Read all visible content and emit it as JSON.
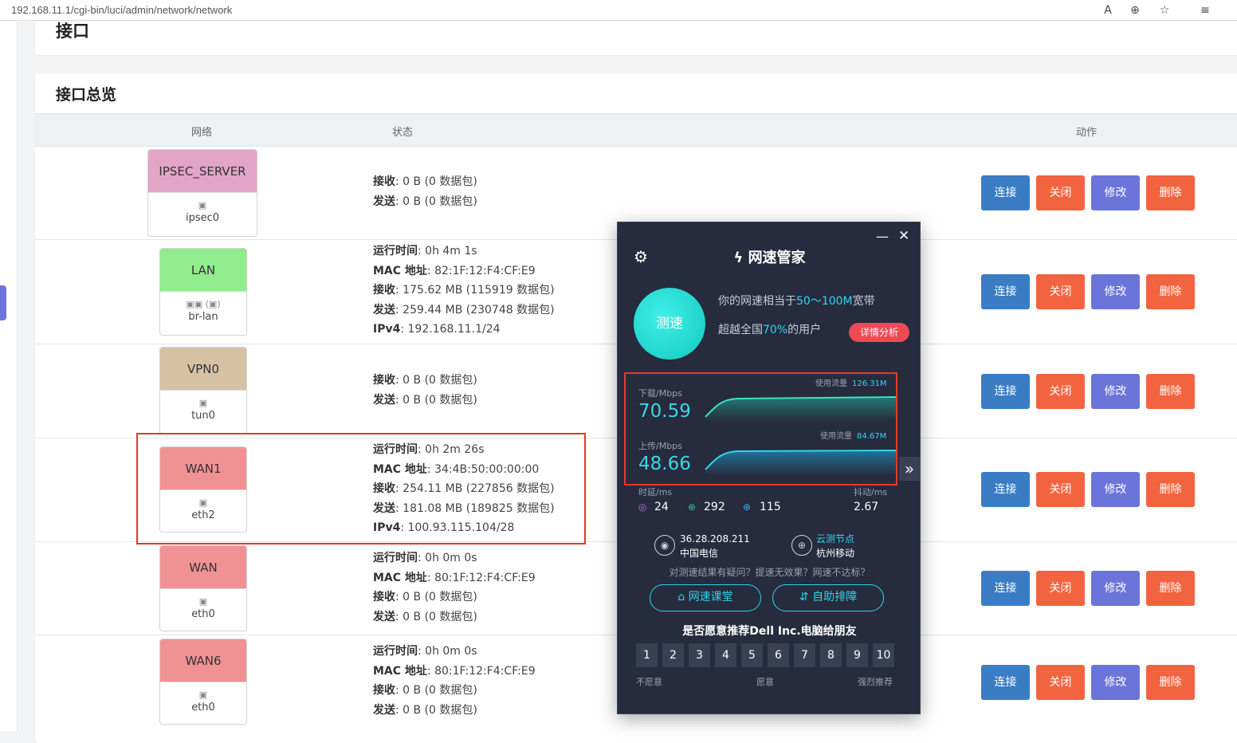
{
  "browser": {
    "url": "192.168.11.1/cgi-bin/luci/admin/network/network",
    "icons": [
      "read-aloud-icon",
      "zoom-icon",
      "favorite-add-icon",
      "favorites-icon"
    ]
  },
  "page": {
    "title": "接口",
    "section_title": "接口总览",
    "columns": {
      "network": "网络",
      "status": "状态",
      "actions": "动作"
    }
  },
  "labels": {
    "uptime": "运行时间",
    "mac": "MAC 地址",
    "rx": "接收",
    "tx": "发送",
    "ipv4": "IPv4"
  },
  "buttons": {
    "connect": "连接",
    "close": "关闭",
    "edit": "修改",
    "delete": "删除"
  },
  "interfaces": [
    {
      "name": "IPSEC_SERVER",
      "device": "ipsec0",
      "color": "#e2a5c7",
      "icon": "ethernet-port-icon",
      "uptime": null,
      "mac": null,
      "rx": "0 B (0 数据包)",
      "tx": "0 B (0 数据包)",
      "ipv4": null
    },
    {
      "name": "LAN",
      "device": "br-lan",
      "color": "#90ec8c",
      "icon": "bridge-icon",
      "uptime": "0h 4m 1s",
      "mac": "82:1F:12:F4:CF:E9",
      "rx": "175.62 MB (115919 数据包)",
      "tx": "259.44 MB (230748 数据包)",
      "ipv4": "192.168.11.1/24"
    },
    {
      "name": "VPN0",
      "device": "tun0",
      "color": "#d6c1a4",
      "icon": "ethernet-port-icon",
      "uptime": null,
      "mac": null,
      "rx": "0 B (0 数据包)",
      "tx": "0 B (0 数据包)",
      "ipv4": null
    },
    {
      "name": "WAN1",
      "device": "eth2",
      "color": "#f09294",
      "icon": "ethernet-port-icon",
      "uptime": "0h 2m 26s",
      "mac": "34:4B:50:00:00:00",
      "rx": "254.11 MB (227856 数据包)",
      "tx": "181.08 MB (189825 数据包)",
      "ipv4": "100.93.115.104/28"
    },
    {
      "name": "WAN",
      "device": "eth0",
      "color": "#f09294",
      "icon": "ethernet-port-icon",
      "uptime": "0h 0m 0s",
      "mac": "80:1F:12:F4:CF:E9",
      "rx": "0 B (0 数据包)",
      "tx": "0 B (0 数据包)",
      "ipv4": null
    },
    {
      "name": "WAN6",
      "device": "eth0",
      "color": "#f09294",
      "icon": "ethernet-port-icon",
      "uptime": "0h 0m 0s",
      "mac": "80:1F:12:F4:CF:E9",
      "rx": "0 B (0 数据包)",
      "tx": "0 B (0 数据包)",
      "ipv4": null
    }
  ],
  "speed_popup": {
    "title": "网速管家",
    "test_button": "测速",
    "line1_prefix": "你的网速相当于",
    "line1_value": "50～100M",
    "line1_suffix": "宽带",
    "line2_prefix": "超越全国",
    "line2_value": "70%",
    "line2_suffix": "的用户",
    "detail_button": "详情分析",
    "download_label": "下载/Mbps",
    "download_value": "70.59",
    "download_usage_label": "使用流量",
    "download_usage": "126.31M",
    "upload_label": "上传/Mbps",
    "upload_value": "48.66",
    "upload_usage_label": "使用流量",
    "upload_usage": "84.67M",
    "latency_label": "时延/ms",
    "jitter_label": "抖动/ms",
    "latency": "24",
    "down_latency": "292",
    "up_latency": "115",
    "jitter": "2.67",
    "ip": "36.28.208.211",
    "isp": "中国电信",
    "node_label": "云测节点",
    "node": "杭州移动",
    "question": "对测速结果有疑问？提速无效果？网速不达标？",
    "course_button": "网速课堂",
    "self_help_button": "自助排障",
    "recommend_question": "是否愿意推荐Dell Inc.电脑给朋友",
    "scores": [
      "1",
      "2",
      "3",
      "4",
      "5",
      "6",
      "7",
      "8",
      "9",
      "10"
    ],
    "scale_low": "不愿意",
    "scale_mid": "愿意",
    "scale_high": "强烈推荐",
    "accent": "#2fd6ee"
  }
}
